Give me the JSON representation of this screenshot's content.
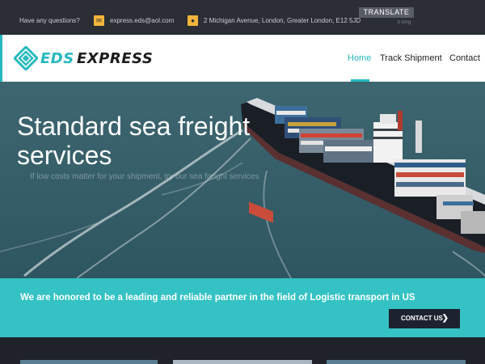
{
  "topbar": {
    "question": "Have any questions?",
    "email": "express.eds@aol.com",
    "address": "2 Michigan Avenue, London, Greater London, E12 5JD",
    "translate_label": "TRANSLATE",
    "bing_label": "b bing"
  },
  "header": {
    "logo_part1": "EDS",
    "logo_part2": "EXPRESS",
    "nav": {
      "home": "Home",
      "track": "Track Shipment",
      "contact": "Contact"
    }
  },
  "hero": {
    "title": "Standard sea freight services",
    "subtitle": "If low costs matter for your shipment, try our sea freight services"
  },
  "banner": {
    "text": "We are honored to be a leading and reliable partner in the field of Logistic transport in US",
    "button_label": "CONTACT US"
  },
  "colors": {
    "accent": "#26b9bf",
    "banner": "#34c2c4",
    "topbar": "#2b2e34",
    "icon_yellow": "#f3b53c"
  },
  "icons": {
    "email": "envelope-icon",
    "address": "map-pin-icon",
    "button": "chevron-right-icon"
  }
}
